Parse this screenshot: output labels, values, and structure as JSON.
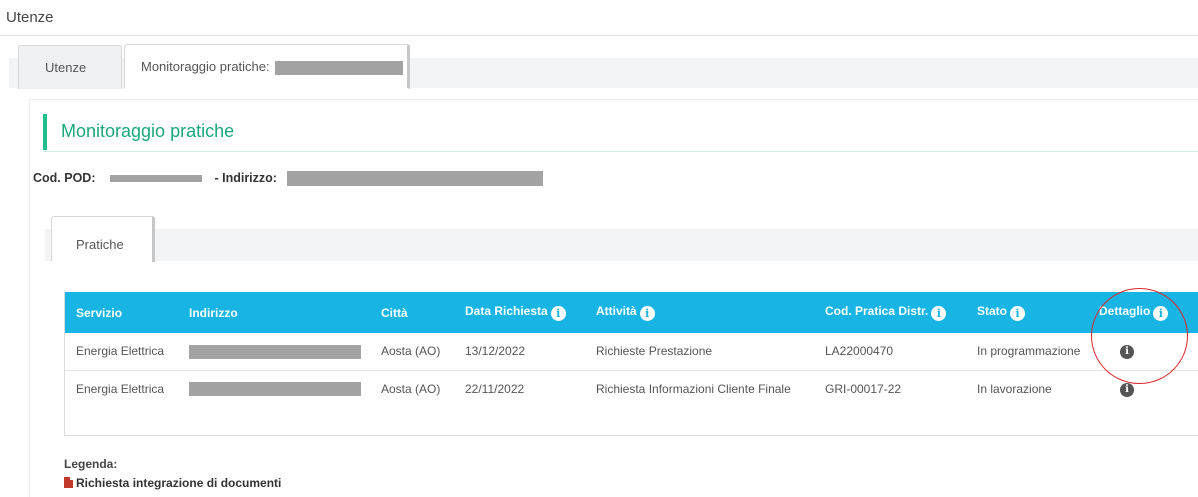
{
  "header": {
    "title": "Utenze"
  },
  "top_tabs": [
    {
      "label": "Utenze",
      "active": false
    },
    {
      "label": "Monitoraggio pratiche:",
      "active": true
    }
  ],
  "section": {
    "title": "Monitoraggio pratiche",
    "pod_label": "Cod. POD:",
    "address_label": "- Indirizzo:"
  },
  "sub_tabs": [
    {
      "label": "Pratiche",
      "active": true
    }
  ],
  "table": {
    "columns": [
      {
        "label": "Servizio",
        "info": false
      },
      {
        "label": "Indirizzo",
        "info": false
      },
      {
        "label": "Città",
        "info": false
      },
      {
        "label": "Data Richiesta",
        "info": true
      },
      {
        "label": "Attività",
        "info": true
      },
      {
        "label": "Cod. Pratica Distr.",
        "info": true
      },
      {
        "label": "Stato",
        "info": true
      },
      {
        "label": "Dettaglio",
        "info": true
      }
    ],
    "rows": [
      {
        "servizio": "Energia Elettrica",
        "citta": "Aosta (AO)",
        "data": "13/12/2022",
        "attivita": "Richieste Prestazione",
        "cod": "LA22000470",
        "stato": "In programmazione"
      },
      {
        "servizio": "Energia Elettrica",
        "citta": "Aosta (AO)",
        "data": "22/11/2022",
        "attivita": "Richiesta Informazioni Cliente Finale",
        "cod": "GRI-00017-22",
        "stato": "In lavorazione"
      }
    ]
  },
  "legend": {
    "title": "Legenda:",
    "items": [
      {
        "label": "Richiesta integrazione di documenti",
        "icon": "document-icon",
        "color": "#c0392b"
      }
    ]
  },
  "colors": {
    "accent_green": "#1aa77c",
    "table_header": "#17b4e4",
    "highlight_circle": "#d9282c"
  }
}
